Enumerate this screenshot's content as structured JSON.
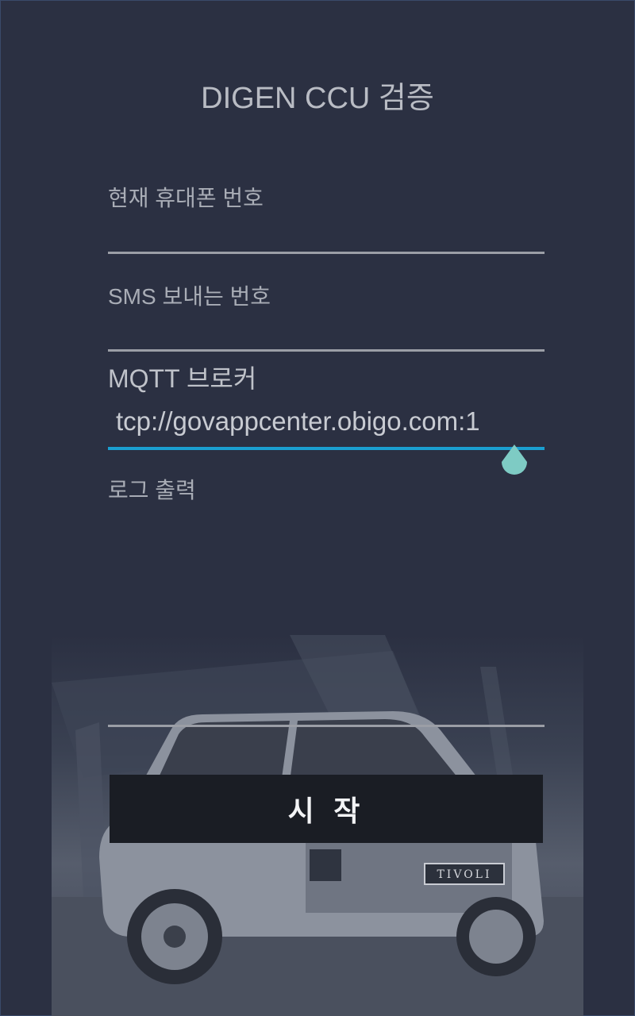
{
  "header": {
    "title": "DIGEN CCU 검증"
  },
  "form": {
    "phone_label": "현재 휴대폰 번호",
    "phone_value": "",
    "sms_label": "SMS 보내는 번호",
    "sms_value": "",
    "mqtt_label": "MQTT 브로커",
    "mqtt_value": "tcp://govappcenter.obigo.com:1",
    "log_label": "로그 출력",
    "log_value": ""
  },
  "actions": {
    "start_label": "시 작"
  },
  "background": {
    "car_badge": "TIVOLI"
  },
  "colors": {
    "background": "#2b3042",
    "accent": "#1a9fd0",
    "handle": "#7ecbc4",
    "button": "#1a1d24"
  }
}
